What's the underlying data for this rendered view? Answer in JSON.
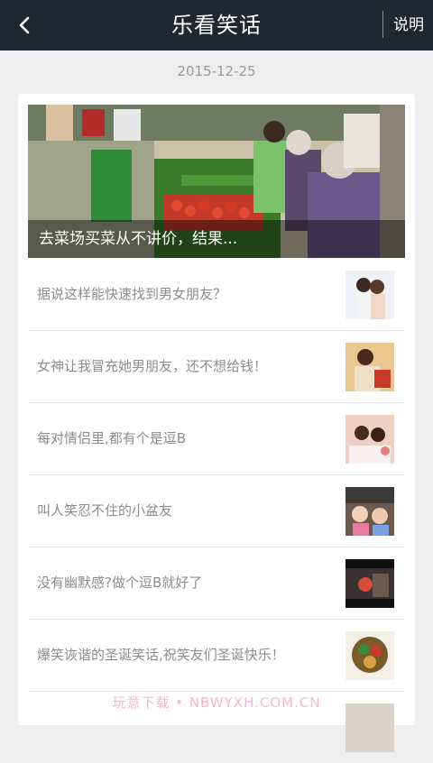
{
  "header": {
    "title": "乐看笑话",
    "help_label": "说明",
    "back_icon": "back-arrow-icon"
  },
  "date": "2015-12-25",
  "hero": {
    "caption": "去菜场买菜从不讲价，结果...",
    "image_alt": "market vegetable stall photo"
  },
  "items": [
    {
      "title": "据说这样能快速找到男女朋友？",
      "thumb": "couple-photo"
    },
    {
      "title": "女神让我冒充她男朋友，还不想给钱！",
      "thumb": "woman-photo"
    },
    {
      "title": "每对情侣里,都有个是逗B",
      "thumb": "couple-bath-photo"
    },
    {
      "title": "叫人笑忍不住的小盆友",
      "thumb": "kids-photo"
    },
    {
      "title": "没有幽默感?做个逗B就好了",
      "thumb": "dark-scene-photo"
    },
    {
      "title": "爆笑诙谐的圣诞笑话,祝笑友们圣诞快乐！",
      "thumb": "christmas-photo"
    }
  ],
  "watermark": "玩意下载 • NBWYXH.COM.CN"
}
